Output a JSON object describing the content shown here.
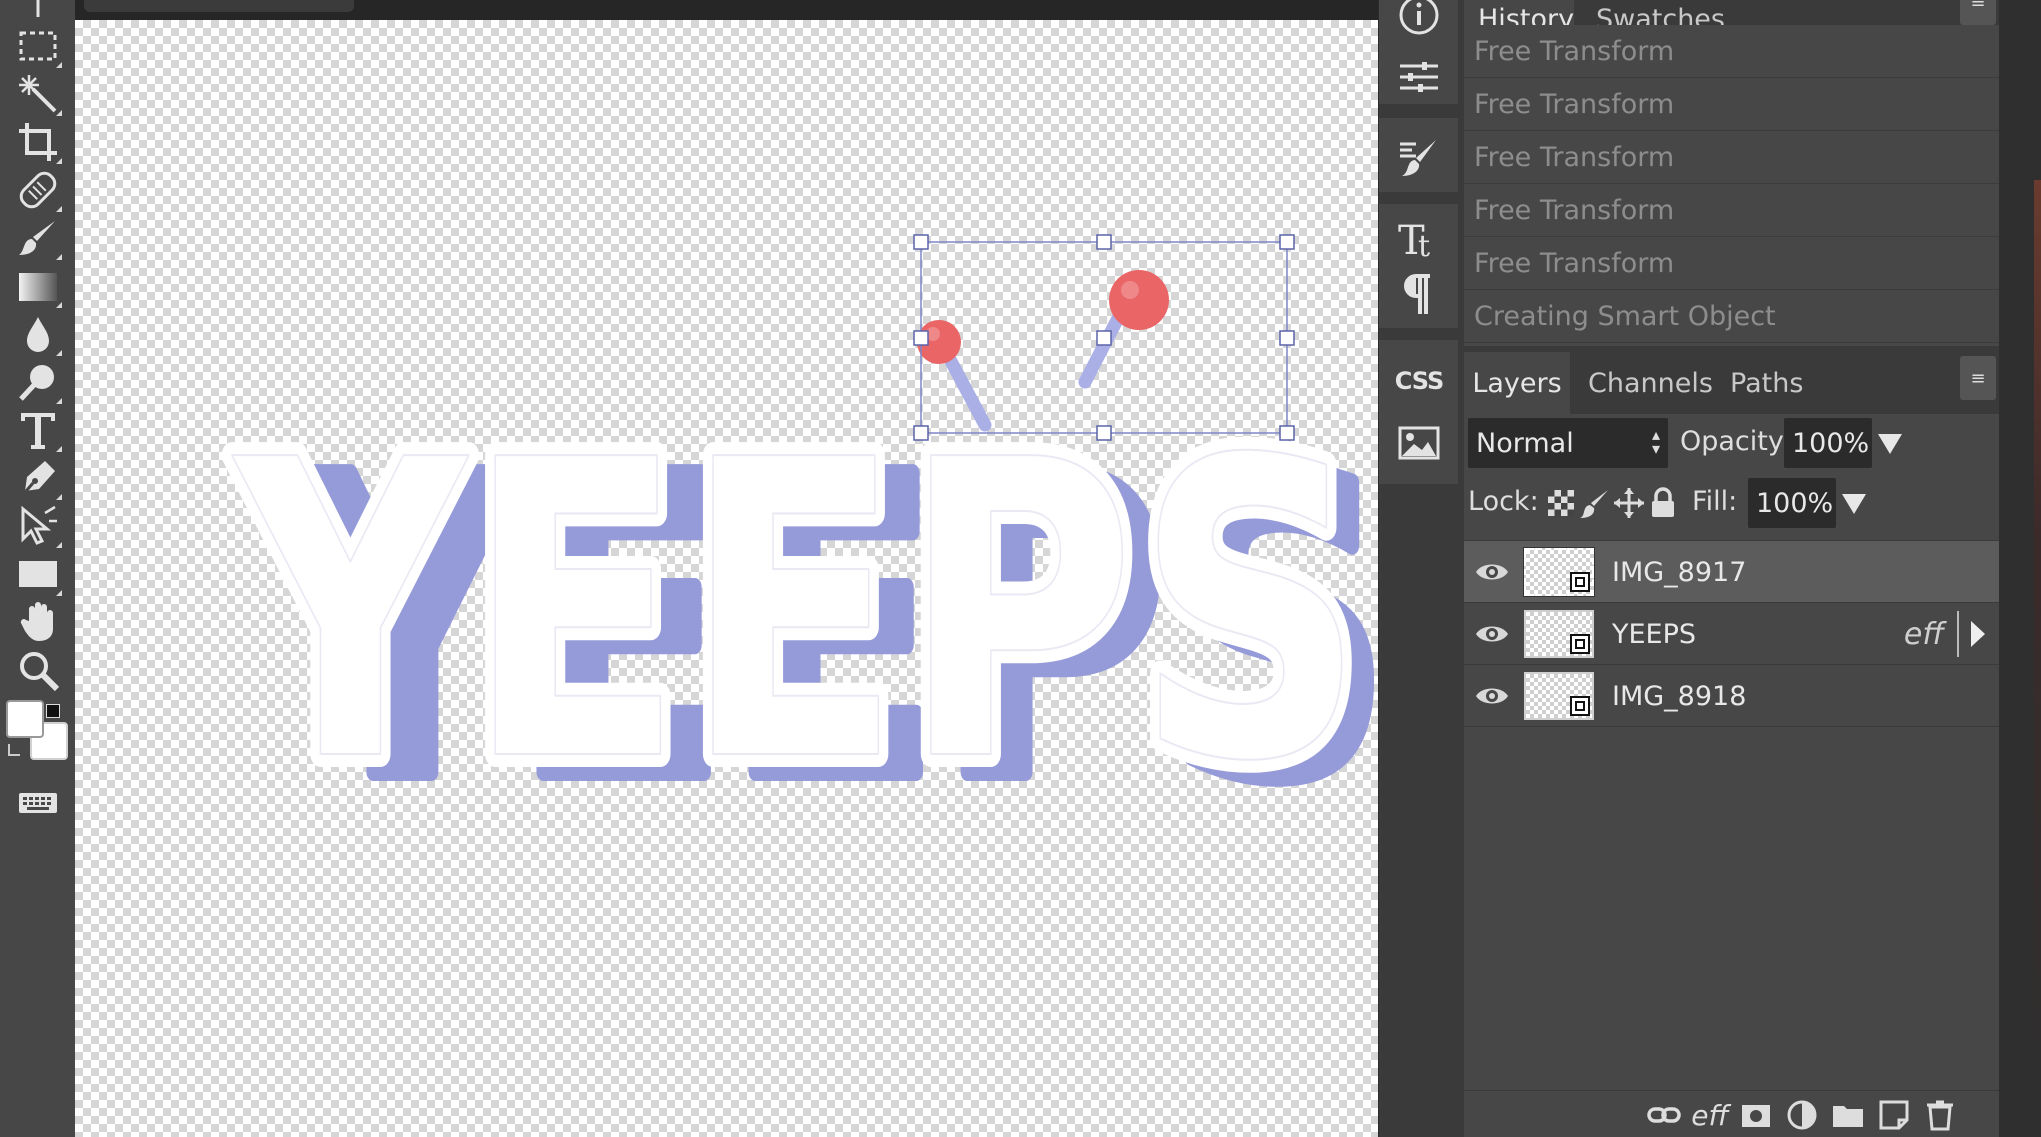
{
  "history_panel": {
    "tabs": [
      {
        "label": "History",
        "active": true
      },
      {
        "label": "Swatches",
        "active": false
      }
    ],
    "items": [
      "Free Transform",
      "Free Transform",
      "Free Transform",
      "Free Transform",
      "Free Transform",
      "Creating Smart Object"
    ]
  },
  "layers_panel": {
    "tabs": [
      {
        "label": "Layers",
        "active": true
      },
      {
        "label": "Channels",
        "active": false
      },
      {
        "label": "Paths",
        "active": false
      }
    ],
    "blend_mode": "Normal",
    "opacity_label": "Opacity:",
    "opacity_value": "100%",
    "lock_label": "Lock:",
    "fill_label": "Fill:",
    "fill_value": "100%",
    "layers": [
      {
        "name": "IMG_8917",
        "visible": true,
        "selected": true,
        "smart_object": true,
        "effects": ""
      },
      {
        "name": "YEEPS",
        "visible": true,
        "selected": false,
        "smart_object": true,
        "effects": "eff"
      },
      {
        "name": "IMG_8918",
        "visible": true,
        "selected": false,
        "smart_object": true,
        "effects": ""
      }
    ],
    "footer_effects_label": "eff"
  },
  "dock": {
    "css_label": "CSS"
  },
  "canvas": {
    "artwork_text": "YEEPS"
  },
  "colors": {
    "text_face": "#ffffff",
    "text_extrusion": "#959ad9",
    "pin_ball": "#e96566",
    "pin_stick": "#aab0e6",
    "selection_box": "#7d86c8",
    "panel_bg": "#474747",
    "field_bg": "#2b2b2b"
  },
  "icons": {
    "toolbar": [
      "move-icon",
      "marquee-icon",
      "magic-wand-icon",
      "crop-icon",
      "healing-icon",
      "brush-icon",
      "gradient-icon",
      "blur-icon",
      "dodge-icon",
      "type-icon",
      "pen-icon",
      "path-select-icon",
      "rectangle-icon",
      "hand-icon",
      "zoom-icon",
      "color-swatch-icon",
      "keyboard-icon"
    ],
    "dock": [
      "info-icon",
      "adjustments-icon",
      "brush-settings-icon",
      "character-icon",
      "paragraph-icon",
      "css-icon",
      "image-icon"
    ],
    "layer_footer": [
      "link-icon",
      "effects-icon",
      "mask-icon",
      "adjustment-layer-icon",
      "folder-icon",
      "new-layer-icon",
      "trash-icon"
    ]
  }
}
